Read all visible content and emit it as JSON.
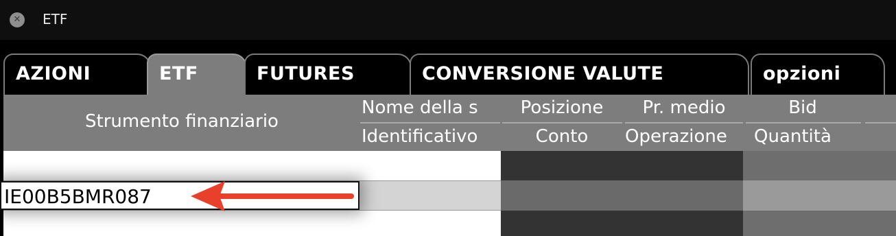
{
  "window": {
    "title": "ETF",
    "close_icon": "close-icon"
  },
  "tabs": [
    {
      "label": "AZIONI",
      "active": false
    },
    {
      "label": "ETF",
      "active": true
    },
    {
      "label": "FUTURES",
      "active": false
    },
    {
      "label": "CONVERSIONE VALUTE",
      "active": false
    },
    {
      "label": "opzioni",
      "active": false
    }
  ],
  "columns": {
    "strumento": "Strumento finanziario",
    "nome": "Nome della s",
    "identificativo": "Identificativo",
    "posizione": "Posizione",
    "conto": "Conto",
    "prezzo_medio": "Pr. medio",
    "operazione": "Operazione",
    "bid": "Bid",
    "quantita": "Quantità"
  },
  "row": {
    "isin_value": "IE00B5BMR087"
  },
  "annotation": {
    "arrow_color": "#e8402a"
  },
  "colors": {
    "header_bg": "#7d7d7d",
    "dark_column": "#333333",
    "selected_row": "#d4d4d4"
  }
}
